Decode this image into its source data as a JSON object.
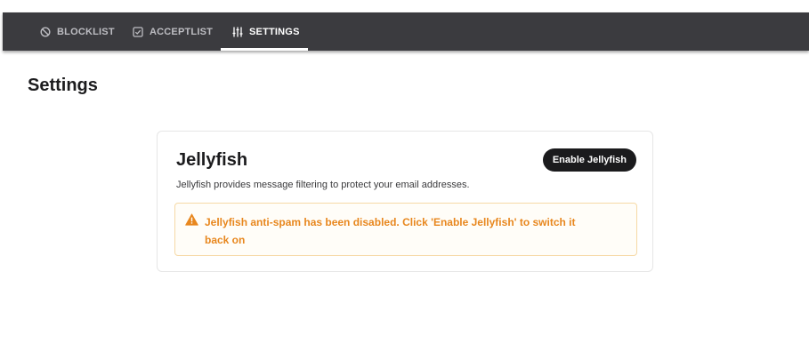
{
  "nav": {
    "tabs": [
      {
        "label": "BLOCKLIST",
        "icon": "blocked-circle-icon",
        "active": false
      },
      {
        "label": "ACCEPTLIST",
        "icon": "checkbox-icon",
        "active": false
      },
      {
        "label": "SETTINGS",
        "icon": "sliders-icon",
        "active": true
      }
    ]
  },
  "page": {
    "title": "Settings"
  },
  "card": {
    "title": "Jellyfish",
    "description": "Jellyfish provides message filtering to protect your email addresses.",
    "enable_button": "Enable Jellyfish",
    "alert": {
      "icon": "warning-triangle-icon",
      "text": "Jellyfish anti-spam has been disabled. Click 'Enable Jellyfish' to switch it back on"
    }
  },
  "colors": {
    "topbar": "#3b3b3f",
    "warning": "#e8871e",
    "button_bg": "#1b1b1d"
  }
}
